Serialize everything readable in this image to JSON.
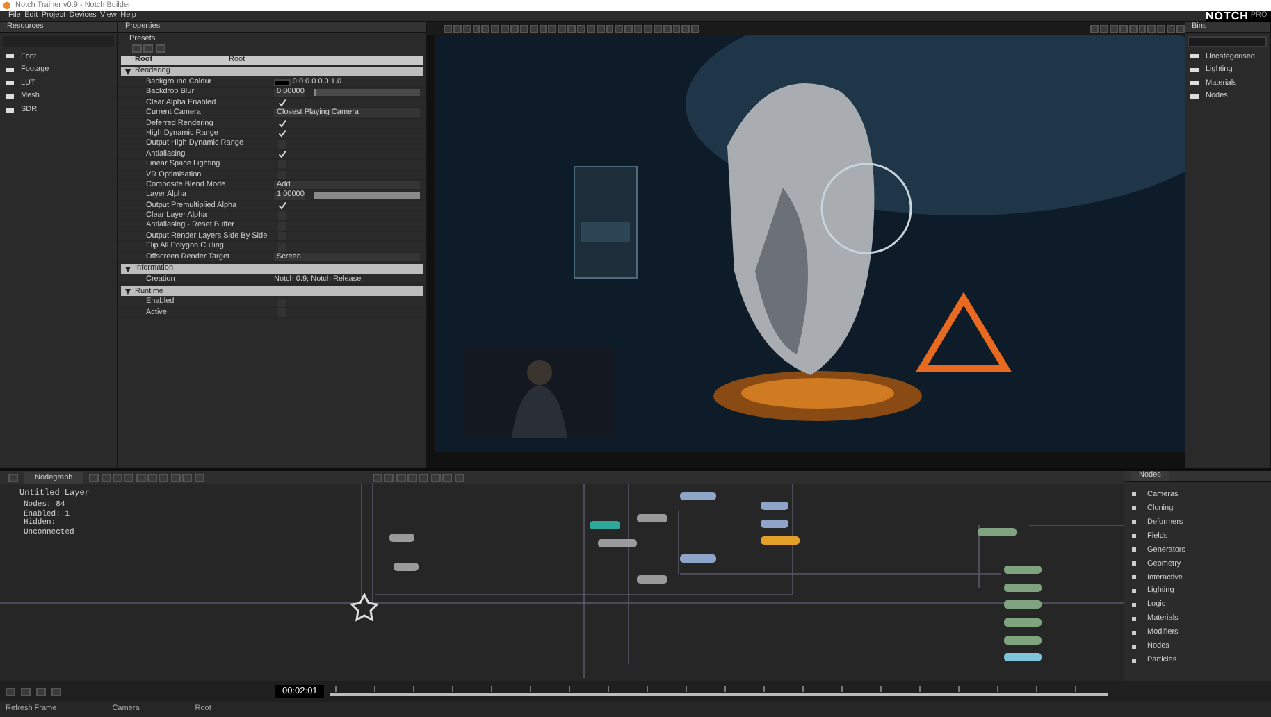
{
  "window": {
    "title": "Notch Trainer v0.9 - Notch Builder"
  },
  "menu": [
    "File",
    "Edit",
    "Project",
    "Devices",
    "View",
    "Help"
  ],
  "logo": {
    "text": "NOTCH",
    "edition": "PRO"
  },
  "resources": {
    "title": "Resources",
    "items": [
      "Font",
      "Footage",
      "LUT",
      "Mesh",
      "SDR"
    ]
  },
  "properties": {
    "title": "Properties",
    "presets": "Presets",
    "header": [
      "Root",
      "Root"
    ],
    "sections": [
      {
        "title": "Rendering",
        "expanded": true,
        "rows": [
          {
            "label": "Background Colour",
            "kind": "color",
            "value": "0.0 0.0 0.0 1.0"
          },
          {
            "label": "Backdrop Blur",
            "kind": "slider",
            "value": "0.00000",
            "level": 0
          },
          {
            "label": "Clear Alpha Enabled",
            "kind": "check",
            "checked": true
          },
          {
            "label": "Current Camera",
            "kind": "select",
            "value": "Closest Playing Camera"
          },
          {
            "label": "Deferred Rendering",
            "kind": "check",
            "checked": true
          },
          {
            "label": "High Dynamic Range",
            "kind": "check",
            "checked": true
          },
          {
            "label": "Output High Dynamic Range",
            "kind": "check",
            "checked": false
          },
          {
            "label": "Antialiasing",
            "kind": "check",
            "checked": true
          },
          {
            "label": "Linear Space Lighting",
            "kind": "check",
            "checked": false
          },
          {
            "label": "VR Optimisation",
            "kind": "check",
            "checked": false
          },
          {
            "label": "Composite Blend Mode",
            "kind": "select",
            "value": "Add"
          },
          {
            "label": "Layer Alpha",
            "kind": "slider",
            "value": "1.00000",
            "level": 1
          },
          {
            "label": "Output Premultiplied Alpha",
            "kind": "check",
            "checked": true
          },
          {
            "label": "Clear Layer Alpha",
            "kind": "check",
            "checked": false
          },
          {
            "label": "Antialiasing - Reset Buffer",
            "kind": "check",
            "checked": false
          },
          {
            "label": "Output Render Layers Side By Side",
            "kind": "check",
            "checked": false
          },
          {
            "label": "Flip All Polygon Culling",
            "kind": "check",
            "checked": false
          },
          {
            "label": "Offscreen Render Target",
            "kind": "select",
            "value": "Screen"
          }
        ]
      },
      {
        "title": "Information",
        "expanded": true,
        "rows": [
          {
            "label": "Creation",
            "kind": "text",
            "value": "Notch 0.9, Notch Release"
          }
        ]
      },
      {
        "title": "Runtime",
        "expanded": true,
        "rows": [
          {
            "label": "Enabled",
            "kind": "check",
            "checked": false
          },
          {
            "label": "Active",
            "kind": "check",
            "checked": false
          }
        ]
      }
    ]
  },
  "bins": {
    "title": "Bins",
    "items": [
      "Uncategorised",
      "Lighting",
      "Materials",
      "Nodes"
    ]
  },
  "nodegraph": {
    "tab": "Nodegraph",
    "layer": "Untitled Layer",
    "stats": [
      "Nodes: 84",
      "Enabled: 1",
      "Hidden:",
      "Unconnected"
    ],
    "nodes": [
      {
        "color": "#9a9a9a"
      },
      {
        "color": "#9a9a9a"
      },
      {
        "color": "#2fa89c"
      },
      {
        "color": "#9a9a9a"
      },
      {
        "color": "#9a9a9a"
      },
      {
        "color": "#9a9a9a"
      },
      {
        "color": "#8ea4c8"
      },
      {
        "color": "#8ea4c8"
      },
      {
        "color": "#8ea4c8"
      },
      {
        "color": "#8ea4c8"
      },
      {
        "color": "#e3a028"
      },
      {
        "color": "#7fa37f"
      },
      {
        "color": "#7fa37f"
      },
      {
        "color": "#7fa37f"
      },
      {
        "color": "#7fa37f"
      },
      {
        "color": "#7fa37f"
      },
      {
        "color": "#7fa37f"
      },
      {
        "color": "#7fc3dc"
      }
    ]
  },
  "palette": {
    "tab": "Nodes",
    "items": [
      "Cameras",
      "Cloning",
      "Deformers",
      "Fields",
      "Generators",
      "Geometry",
      "Interactive",
      "Lighting",
      "Logic",
      "Materials",
      "Modifiers",
      "Nodes",
      "Particles"
    ]
  },
  "timeline": {
    "time": "00:02:01"
  },
  "status_bar": [
    "Refresh Frame",
    "Camera",
    "Root"
  ]
}
